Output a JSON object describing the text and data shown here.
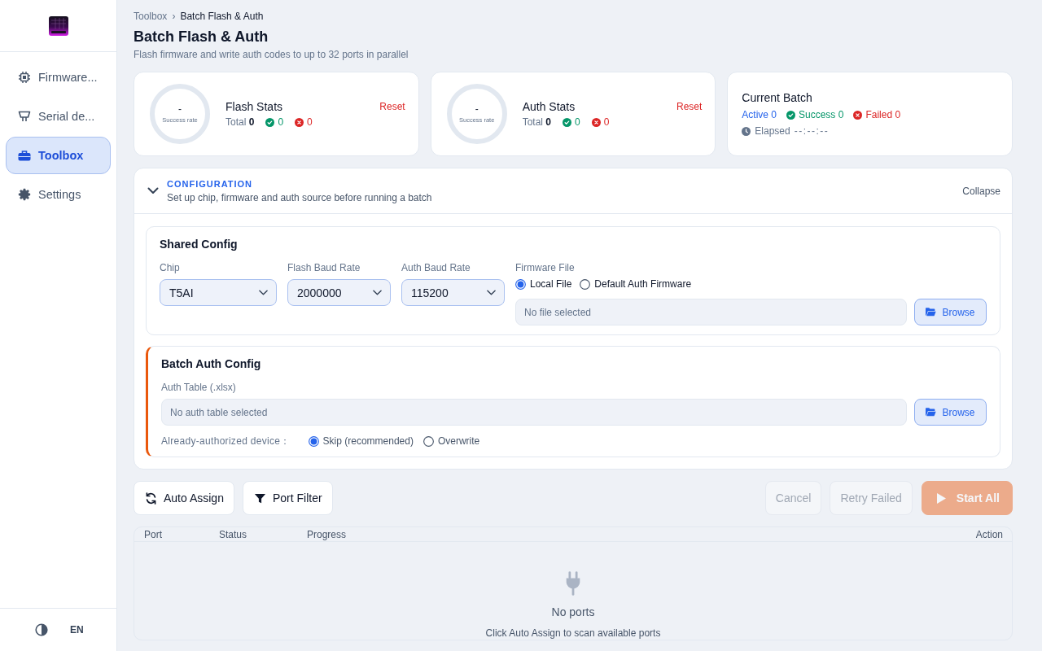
{
  "sidebar": {
    "items": [
      {
        "label": "Firmware...",
        "selected": false
      },
      {
        "label": "Serial de...",
        "selected": false
      },
      {
        "label": "Toolbox",
        "selected": true
      },
      {
        "label": "Settings",
        "selected": false
      }
    ],
    "language": "EN"
  },
  "breadcrumb": {
    "items": [
      "Toolbox",
      "Batch Flash & Auth"
    ],
    "separator": "›"
  },
  "header": {
    "title": "Batch Flash & Auth",
    "subtitle": "Flash firmware and write auth codes to up to 32 ports in parallel"
  },
  "stats": [
    {
      "rate": "-",
      "rate_label": "Success rate",
      "title": "Flash Stats",
      "total": "Total **0**",
      "success": "0",
      "failed": "0",
      "reset": "Reset"
    },
    {
      "rate": "-",
      "rate_label": "Success rate",
      "title": "Auth Stats",
      "total": "Total **0**",
      "success": "0",
      "failed": "0",
      "reset": "Reset"
    }
  ],
  "current_batch": {
    "title": "Current Batch",
    "active": "Active 0",
    "success": "Success 0",
    "failed": "Failed 0",
    "elapsed_label": "Elapsed",
    "elapsed": "--:--:--"
  },
  "configuration": {
    "expanded": true,
    "heading": "CONFIGURATION",
    "description": "Set up chip, firmware and auth source before running a batch",
    "toggle": "Collapse",
    "shared": {
      "title": "Shared Config",
      "selects": [
        {
          "label": "Chip",
          "value": "T5AI"
        },
        {
          "label": "Flash Baud Rate",
          "value": "2000000"
        },
        {
          "label": "Auth Baud Rate",
          "value": "115200"
        }
      ],
      "firmware": {
        "label": "Firmware File",
        "options": [
          {
            "label": "Local File",
            "selected": true
          },
          {
            "label": "Default Auth Firmware",
            "selected": false
          }
        ],
        "placeholder": "No file selected",
        "button": "Browse"
      }
    },
    "auth": {
      "title": "Batch Auth Config",
      "table_label": "Auth Table (.xlsx)",
      "placeholder": "No auth table selected",
      "button": "Browse",
      "existing_label": "Already-authorized device：",
      "options": [
        {
          "label": "Skip (recommended)",
          "selected": true
        },
        {
          "label": "Overwrite",
          "selected": false
        }
      ]
    }
  },
  "actions": {
    "tools": [
      "Auto Assign",
      "Port Filter"
    ],
    "run": [
      {
        "kind": "secondary",
        "label": "Cancel",
        "disabled": true
      },
      {
        "kind": "secondary",
        "label": "Retry Failed",
        "disabled": true
      },
      {
        "kind": "primary",
        "label": "Start All",
        "disabled": true
      }
    ]
  },
  "ports": {
    "columns": [
      "Port",
      "Status",
      "Progress",
      "Action"
    ],
    "empty_title": "No ports",
    "empty_hint": "Click Auto Assign to scan available ports"
  }
}
